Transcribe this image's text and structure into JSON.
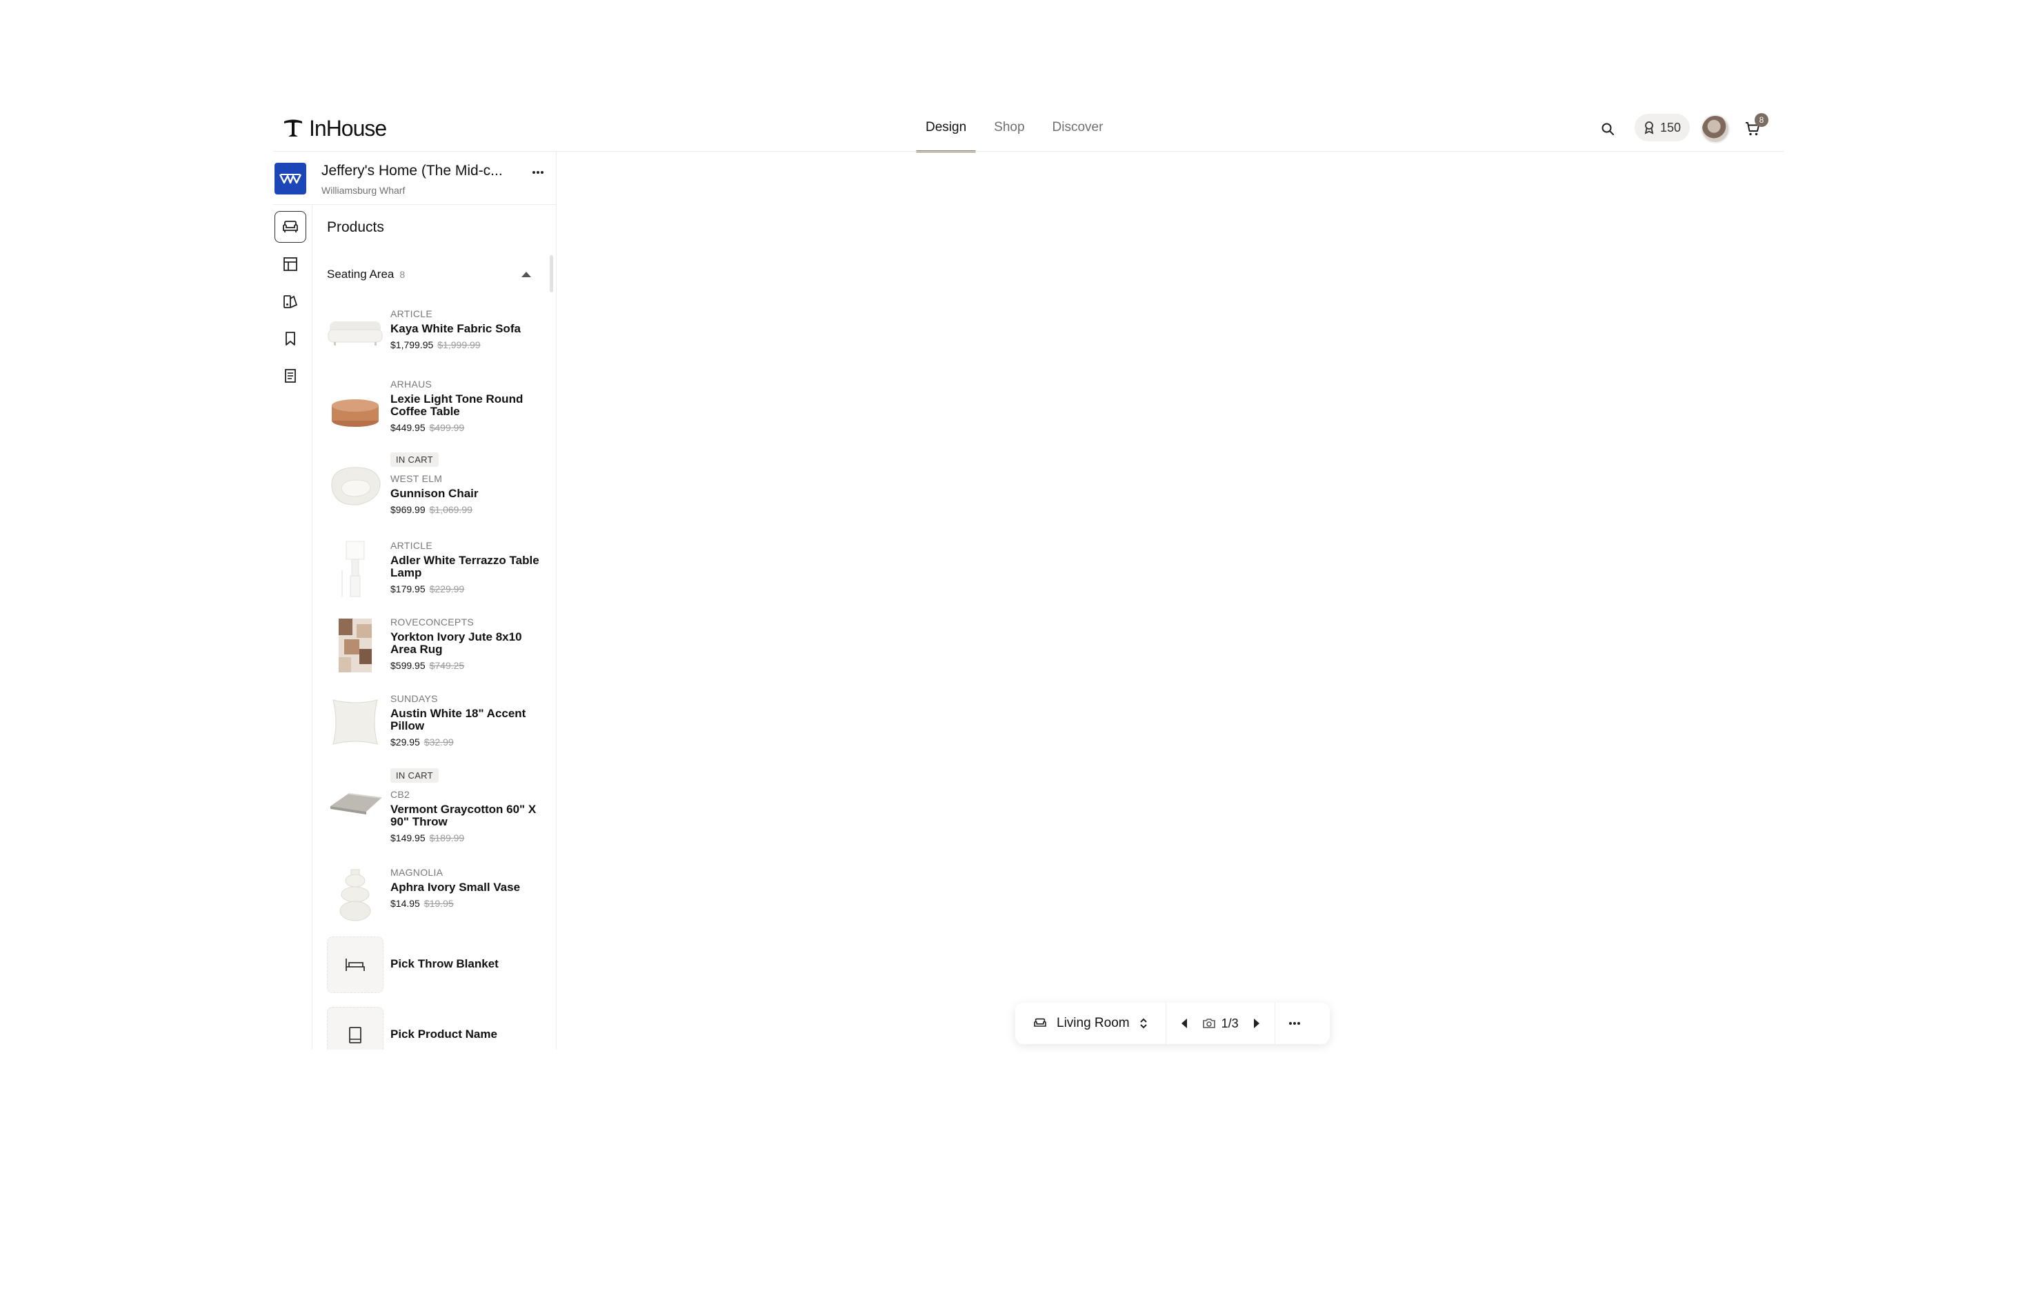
{
  "header": {
    "logo_text": "InHouse",
    "nav": [
      {
        "label": "Design",
        "active": true
      },
      {
        "label": "Shop",
        "active": false
      },
      {
        "label": "Discover",
        "active": false
      }
    ],
    "points": "150",
    "cart_count": "8"
  },
  "project": {
    "title": "Jeffery's Home (The Mid-c...",
    "subtitle": "Williamsburg Wharf",
    "badge_color": "#1c46b8"
  },
  "sidebar": {
    "rail": [
      "sofa-icon",
      "layout-icon",
      "swatch-icon",
      "bookmark-icon",
      "document-icon"
    ],
    "products_title": "Products",
    "section": {
      "label": "Seating Area",
      "count": "8"
    },
    "items": [
      {
        "brand": "ARTICLE",
        "name": "Kaya White Fabric Sofa",
        "price": "$1,799.95",
        "old_price": "$1,999.99",
        "in_cart": ""
      },
      {
        "brand": "ARHAUS",
        "name": "Lexie Light Tone Round Coffee Table",
        "price": "$449.95",
        "old_price": "$499.99",
        "in_cart": ""
      },
      {
        "brand": "WEST ELM",
        "name": "Gunnison Chair",
        "price": "$969.99",
        "old_price": "$1,069.99",
        "in_cart": "IN CART"
      },
      {
        "brand": "ARTICLE",
        "name": "Adler White Terrazzo Table Lamp",
        "price": "$179.95",
        "old_price": "$229.99",
        "in_cart": ""
      },
      {
        "brand": "ROVECONCEPTS",
        "name": "Yorkton Ivory Jute 8x10 Area Rug",
        "price": "$599.95",
        "old_price": "$749.25",
        "in_cart": ""
      },
      {
        "brand": "SUNDAYS",
        "name": "Austin White 18\" Accent Pillow",
        "price": "$29.95",
        "old_price": "$32.99",
        "in_cart": ""
      },
      {
        "brand": "CB2",
        "name": "Vermont Graycotton 60\" X 90\" Throw",
        "price": "$149.95",
        "old_price": "$189.99",
        "in_cart": "IN CART"
      },
      {
        "brand": "MAGNOLIA",
        "name": "Aphra Ivory Small Vase",
        "price": "$14.95",
        "old_price": "$19.95",
        "in_cart": ""
      }
    ],
    "picks": [
      {
        "label": "Pick Throw Blanket",
        "icon": "bed-icon"
      },
      {
        "label": "Pick Product Name",
        "icon": "tablet-icon"
      }
    ]
  },
  "toolbar": {
    "room": "Living Room",
    "view_counter": "1/3"
  }
}
